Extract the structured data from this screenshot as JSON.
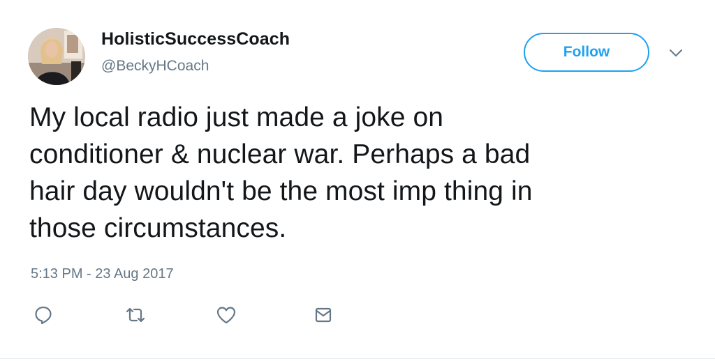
{
  "user": {
    "display_name": "HolisticSuccessCoach",
    "handle": "@BeckyHCoach"
  },
  "follow_button": {
    "label": "Follow"
  },
  "tweet": {
    "text": "My local radio just made a joke on\nconditioner & nuclear war. Perhaps a bad\nhair day wouldn't be the most imp thing in\nthose circumstances.",
    "timestamp": "5:13 PM - 23 Aug 2017"
  },
  "actions": [
    {
      "name": "reply",
      "icon": "reply-icon"
    },
    {
      "name": "retweet",
      "icon": "retweet-icon"
    },
    {
      "name": "like",
      "icon": "heart-icon"
    },
    {
      "name": "direct-message",
      "icon": "envelope-icon"
    }
  ],
  "colors": {
    "accent": "#1da1f2",
    "text": "#14171a",
    "secondary_text": "#657786",
    "icon": "#657786"
  }
}
